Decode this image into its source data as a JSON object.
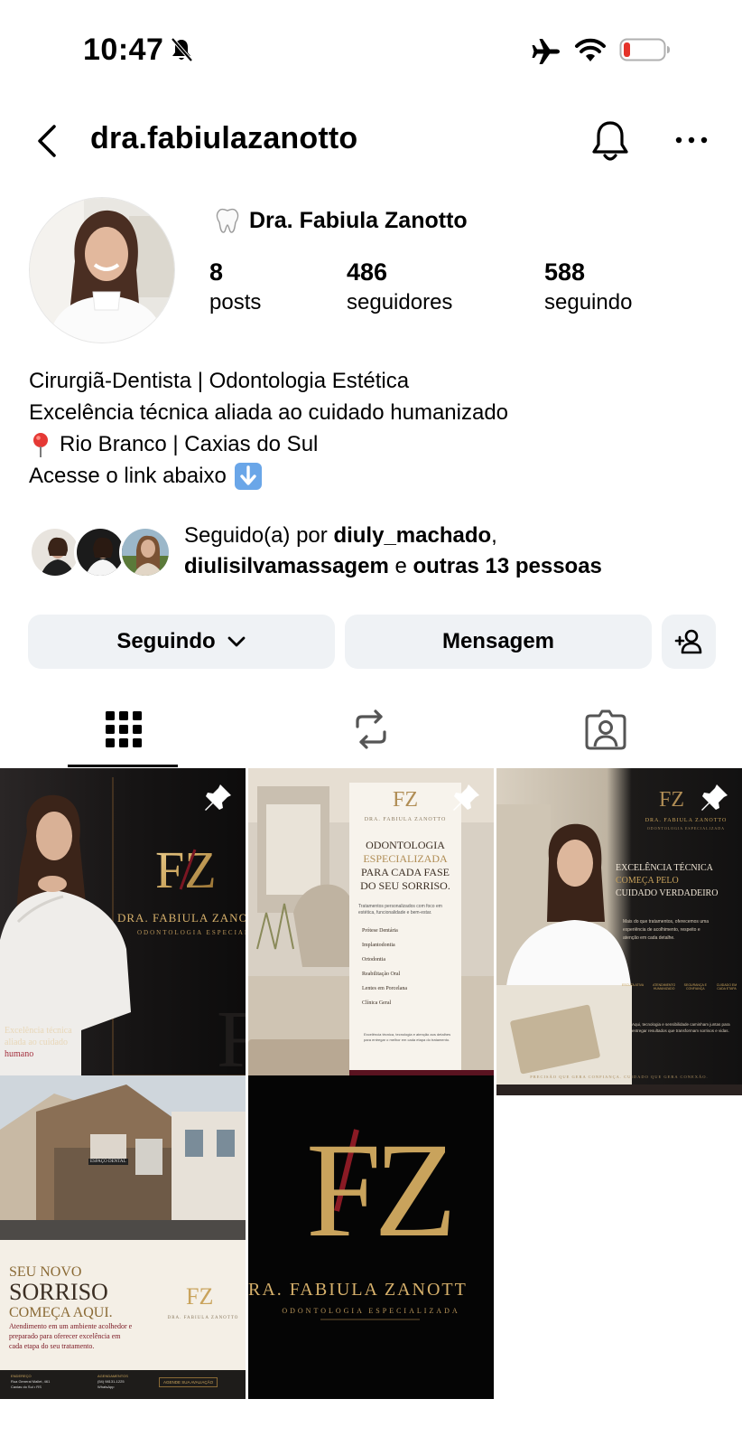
{
  "status_bar": {
    "time": "10:47"
  },
  "header": {
    "username": "dra.fabiulazanotto"
  },
  "profile": {
    "display_name": "Dra. Fabiula Zanotto",
    "stats": [
      {
        "number": "8",
        "label": "posts"
      },
      {
        "number": "486",
        "label": "seguidores"
      },
      {
        "number": "588",
        "label": "seguindo"
      }
    ],
    "bio": {
      "line1": "Cirurgiã-Dentista | Odontologia Estética",
      "line2": "Excelência técnica aliada ao cuidado humanizado",
      "line3": "Rio Branco | Caxias do Sul",
      "line4": "Acesse o link abaixo"
    },
    "followed_by": {
      "prefix": "Seguido(a) por ",
      "user1": "diuly_machado",
      "sep": ",",
      "user2": "diulisilvamassagem",
      "connector": " e ",
      "others": "outras 13 pessoas"
    }
  },
  "buttons": {
    "following": "Seguindo",
    "message": "Mensagem"
  },
  "tabs": [
    "grid",
    "reposts",
    "tagged"
  ],
  "posts": {
    "p1": {
      "monogram": "FZ",
      "name": "DRA. FABIULA ZANOTTO",
      "sub": "ODONTOLOGIA ESPECIALIZADA",
      "caption1": "Excelência técnica",
      "caption2": "aliada ao cuidado",
      "caption3": "humano"
    },
    "p2": {
      "monogram": "FZ",
      "brand": "DRA. FABIULA ZANOTTO",
      "title1": "ODONTOLOGIA",
      "title2": "ESPECIALIZADA",
      "title3": "PARA CADA FASE",
      "title4": "DO SEU SORRISO.",
      "intro": "Tratamentos personalizados com foco em estética, funcionalidade e bem-estar.",
      "items": [
        "Prótese Dentária",
        "Implantodontia",
        "Ortodontia",
        "Reabilitação Oral",
        "Lentes em Porcelana",
        "Clínica Geral"
      ],
      "footer_note": "Excelência técnica, tecnologia e atenção aos detalhes para entregar o melhor em cada etapa do tratamento.",
      "footer": "PRECISÃO TÉCNICA. OLHAR HUMANO. RESULTADO REAL."
    },
    "p3": {
      "monogram": "FZ",
      "brand": "DRA. FABIULA ZANOTTO",
      "sub": "ODONTOLOGIA ESPECIALIZADA",
      "title1": "EXCELÊNCIA TÉCNICA",
      "title2": "COMEÇA PELO",
      "title3": "CUIDADO VERDADEIRO",
      "body": "Mais do que tratamentos, oferecemos uma experiência de acolhimento, respeito e atenção em cada detalhe.",
      "pillars": [
        "ESCUTA ATIVA",
        "ATENDIMENTO HUMANIZADO",
        "SEGURANÇA E CONFIANÇA",
        "CUIDADO EM CADA ETAPA"
      ],
      "note": "Aqui, tecnologia e sensibilidade caminham juntas para entregar resultados que transformam sorrisos e vidas.",
      "footer": "PRECISÃO QUE GERA CONFIANÇA. CUIDADO QUE GERA CONEXÃO."
    },
    "p4": {
      "sign": "ESPAÇO DENTAL",
      "headline1": "SEU NOVO",
      "headline2": "SORRISO",
      "headline3": "COMEÇA AQUI.",
      "body": "Atendimento em um ambiente acolhedor e preparado para oferecer excelência em cada etapa do seu tratamento.",
      "monogram": "FZ",
      "brand": "DRA. FABIULA ZANOTTO",
      "addr_label": "ENDEREÇO",
      "addr": "Rua General Mallet, 461",
      "city": "Caxias do Sul • RS",
      "sched_label": "AGENDAMENTOS",
      "phone": "(54) 98131-1225",
      "whatsapp": "WhatsApp",
      "cta": "AGENDE SUA AVALIAÇÃO"
    },
    "p5": {
      "monogram": "FZ",
      "name": "RA. FABIULA ZANOTT",
      "sub": "ODONTOLOGIA ESPECIALIZADA"
    }
  },
  "colors": {
    "button_bg": "#eff2f5",
    "gold": "#c9a35c",
    "wine": "#6b1423",
    "battery_low": "#e5332a"
  }
}
